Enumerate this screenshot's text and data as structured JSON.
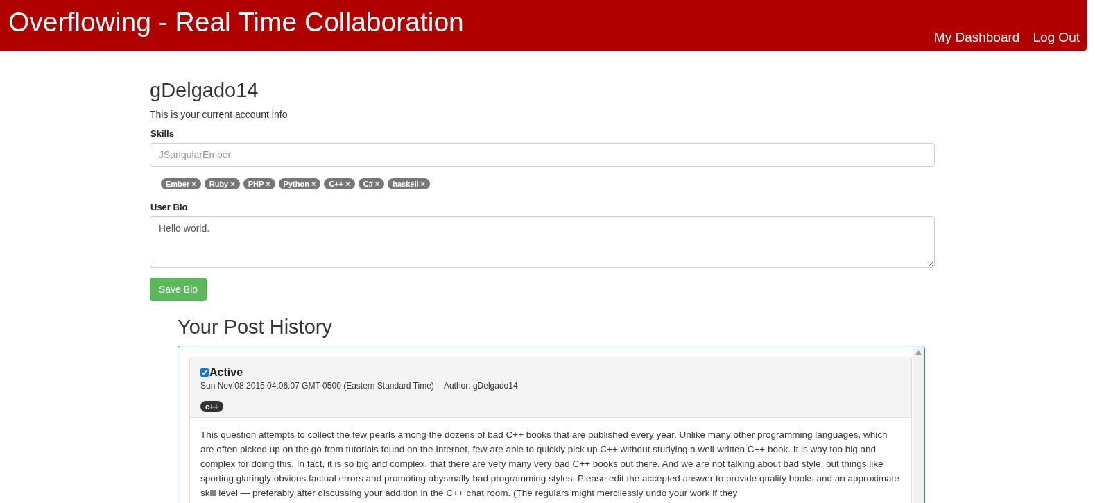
{
  "header": {
    "title": "Overflowing - Real Time Collaboration",
    "nav": [
      "My Dashboard",
      "Log Out"
    ]
  },
  "account": {
    "username": "gDelgado14",
    "intro": "This is your current account info",
    "skills_label": "Skills",
    "skills_placeholder": "JSangularEmber",
    "skills": [
      "Ember",
      "Ruby",
      "PHP",
      "Python",
      "C++",
      "C#",
      "haskell"
    ],
    "remove_mark": "×",
    "bio_label": "User Bio",
    "bio": "Hello world.",
    "save_button": "Save Bio"
  },
  "post_history": {
    "title": "Your Post History",
    "posts": [
      {
        "active": true,
        "status": "Active",
        "date": "Sun Nov 08 2015 04:06:07 GMT-0500 (Eastern Standard Time)",
        "author": "Author: gDelgado14",
        "tags": [
          "c++"
        ],
        "body": "This question attempts to collect the few pearls among the dozens of bad C++ books that are published every year. Unlike many other programming languages, which are often picked up on the go from tutorials found on the Internet, few are able to quickly pick up C++ without studying a well-written C++ book. It is way too big and complex for doing this. In fact, it is so big and complex, that there are very many very bad C++ books out there. And we are not talking about bad style, but things like sporting glaringly obvious factual errors and promoting abysmally bad programming styles. Please edit the accepted answer to provide quality books and an approximate skill level — preferably after discussing your addition in the C++ chat room. (The regulars might mercilessly undo your work if they"
      }
    ]
  }
}
